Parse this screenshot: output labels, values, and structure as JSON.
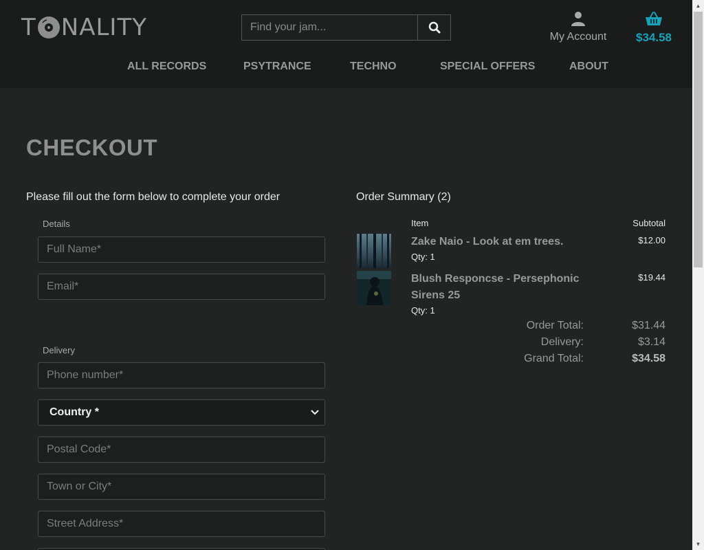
{
  "header": {
    "logo_left": "T",
    "logo_right": "NALITY",
    "search_placeholder": "Find your jam...",
    "account_label": "My Account",
    "basket_total": "$34.58",
    "accent_color": "#17a2b8"
  },
  "nav": [
    {
      "label": "ALL RECORDS"
    },
    {
      "label": "PSYTRANCE"
    },
    {
      "label": "TECHNO"
    },
    {
      "label": "SPECIAL OFFERS"
    },
    {
      "label": "ABOUT"
    }
  ],
  "checkout": {
    "title": "CHECKOUT",
    "intro": "Please fill out the form below to complete your order",
    "details_legend": "Details",
    "full_name_placeholder": "Full Name*",
    "email_placeholder": "Email*",
    "delivery_legend": "Delivery",
    "phone_placeholder": "Phone number*",
    "country_selected": "Country *",
    "postal_placeholder": "Postal Code*",
    "town_placeholder": "Town or City*",
    "street_placeholder": "Street Address*"
  },
  "summary": {
    "title": "Order Summary (2)",
    "col_item": "Item",
    "col_subtotal": "Subtotal",
    "items": [
      {
        "name_line1": "Zake Naio - Look at em trees.",
        "name_line2": "",
        "qty": "Qty: 1",
        "subtotal": "$12.00"
      },
      {
        "name_line1": "Blush Responcse - Persephonic",
        "name_line2": "Sirens 25",
        "qty": "Qty: 1",
        "subtotal": "$19.44"
      }
    ],
    "order_total_label": "Order Total:",
    "order_total": "$31.44",
    "delivery_label": "Delivery:",
    "delivery": "$3.14",
    "grand_total_label": "Grand Total:",
    "grand_total": "$34.58"
  }
}
